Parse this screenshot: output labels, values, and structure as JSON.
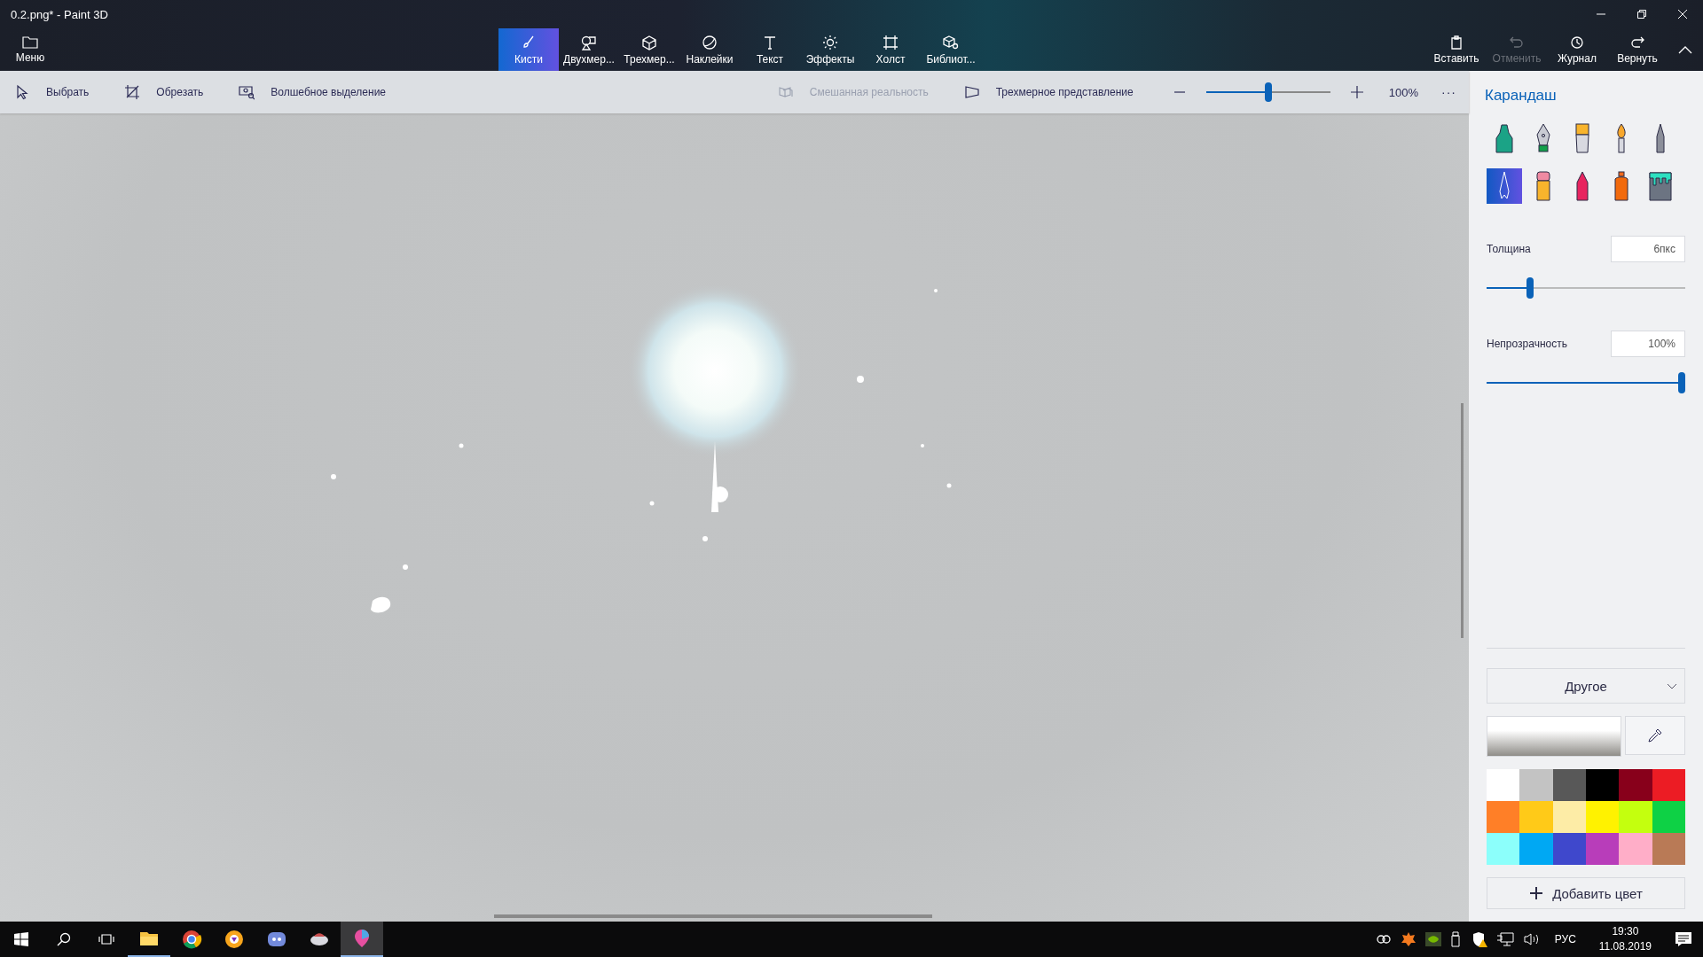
{
  "window": {
    "title": "0.2.png* - Paint 3D"
  },
  "menu_button": {
    "label": "Меню"
  },
  "tabs": [
    {
      "kind": "brush",
      "label": "Кисти",
      "selected": true
    },
    {
      "kind": "shapes",
      "label": "Двухмер...",
      "selected": false
    },
    {
      "kind": "cube",
      "label": "Трехмер...",
      "selected": false
    },
    {
      "kind": "sticker",
      "label": "Наклейки",
      "selected": false
    },
    {
      "kind": "text",
      "label": "Текст",
      "selected": false
    },
    {
      "kind": "sun",
      "label": "Эффекты",
      "selected": false
    },
    {
      "kind": "canvas",
      "label": "Холст",
      "selected": false
    },
    {
      "kind": "library",
      "label": "Библиот...",
      "selected": false
    }
  ],
  "actions": [
    {
      "kind": "paste",
      "label": "Вставить",
      "disabled": false
    },
    {
      "kind": "undo",
      "label": "Отменить",
      "disabled": true
    },
    {
      "kind": "history",
      "label": "Журнал",
      "disabled": false
    },
    {
      "kind": "redo",
      "label": "Вернуть",
      "disabled": false
    }
  ],
  "toolbar": {
    "left": [
      {
        "kind": "select",
        "label": "Выбрать"
      },
      {
        "kind": "crop",
        "label": "Обрезать"
      },
      {
        "kind": "magic",
        "label": "Волшебное выделение"
      }
    ],
    "mixed_reality": {
      "label": "Смешанная реальность",
      "disabled": true
    },
    "view_3d": {
      "label": "Трехмерное представление"
    },
    "zoom": {
      "level": 0.5,
      "reading": "100%"
    },
    "more": "···"
  },
  "panel": {
    "title": "Карандаш",
    "tools": [
      {
        "kind": "marker",
        "selected": false
      },
      {
        "kind": "pen",
        "selected": false
      },
      {
        "kind": "flat-brush",
        "selected": false
      },
      {
        "kind": "round-brush",
        "selected": false
      },
      {
        "kind": "fine-pencil",
        "selected": false
      },
      {
        "kind": "pencil",
        "selected": true
      },
      {
        "kind": "eraser",
        "selected": false
      },
      {
        "kind": "crayon",
        "selected": false
      },
      {
        "kind": "spray",
        "selected": false
      },
      {
        "kind": "bucket",
        "selected": false
      }
    ],
    "thickness": {
      "label": "Толщина",
      "value": "6пкс",
      "level": 0.21
    },
    "opacity": {
      "label": "Непрозрачность",
      "value": "100%",
      "level": 1
    },
    "finish": {
      "value": "Другое"
    },
    "palette": [
      {
        "color": "#ffffff"
      },
      {
        "color": "#c3c3c3"
      },
      {
        "color": "#585858"
      },
      {
        "color": "#000000"
      },
      {
        "color": "#88001b"
      },
      {
        "color": "#ec1c24"
      },
      {
        "color": "#ff7f27"
      },
      {
        "color": "#ffca18"
      },
      {
        "color": "#fdeca6"
      },
      {
        "color": "#fff200"
      },
      {
        "color": "#c4ff0e"
      },
      {
        "color": "#0ed145"
      },
      {
        "color": "#8cfffb"
      },
      {
        "color": "#00a8f3"
      },
      {
        "color": "#3f48cc"
      },
      {
        "color": "#b83dba"
      },
      {
        "color": "#ffaec8"
      },
      {
        "color": "#b97a56"
      }
    ],
    "add_color": "Добавить цвет"
  },
  "taskbar": {
    "apps": [
      {
        "kind": "explorer",
        "running": true,
        "selected": false
      },
      {
        "kind": "chrome",
        "running": false,
        "selected": false
      },
      {
        "kind": "browser",
        "running": false,
        "selected": false
      },
      {
        "kind": "discord",
        "running": false,
        "selected": false
      },
      {
        "kind": "game",
        "running": false,
        "selected": false
      },
      {
        "kind": "paint3d",
        "running": true,
        "selected": true
      }
    ],
    "language": "РУС",
    "time": "19:30",
    "date": "11.08.2019"
  }
}
